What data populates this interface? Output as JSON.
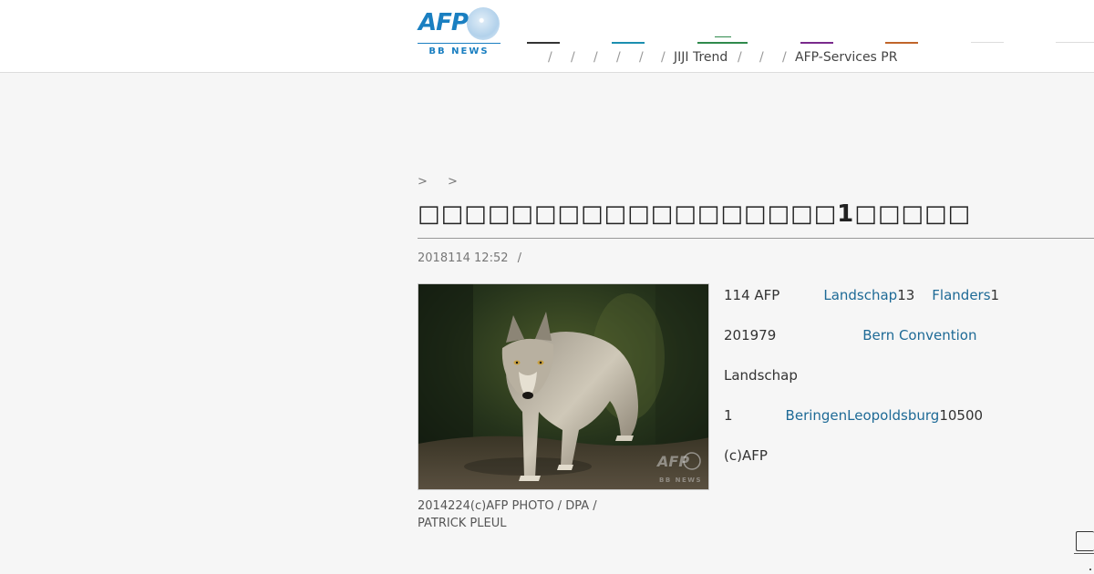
{
  "logo": {
    "brand": "AFP",
    "sub": "BB NEWS"
  },
  "colors": {
    "nav_bars": [
      "#333333",
      "#1b8fb0",
      "#2f8a4c",
      "#7a2a8c",
      "#c0652a",
      "#dddddd",
      "#dddddd"
    ],
    "link": "#1e6a96"
  },
  "nav": {
    "separators": [
      "/",
      "/",
      "/",
      "/",
      "/",
      "/",
      "/",
      "/"
    ],
    "jiji": "JIJI Trend",
    "afp_services": "AFP-Services PR"
  },
  "breadcrumb": [
    ">",
    ">"
  ],
  "article": {
    "title": "□□□□□□□□□□□□□□□□□□1□□□□□",
    "date": "2018114 12:52",
    "date_sep": "/",
    "caption": "2014224(c)AFP PHOTO / DPA / PATRICK PLEUL",
    "watermark": "AFP",
    "watermark_sub": "BB NEWS",
    "lines": [
      {
        "t1": "114 AFP",
        "a1": "Landschap",
        "t2": "13",
        "a2": "Flanders",
        "t3": "1"
      },
      {
        "t1": "201979",
        "a1": "Bern Convention"
      },
      {
        "t1": "Landschap"
      },
      {
        "t1": "1",
        "a1": "BeringenLeopoldsburg",
        "t2": "10500"
      },
      {
        "t1": "(c)AFP"
      }
    ]
  }
}
